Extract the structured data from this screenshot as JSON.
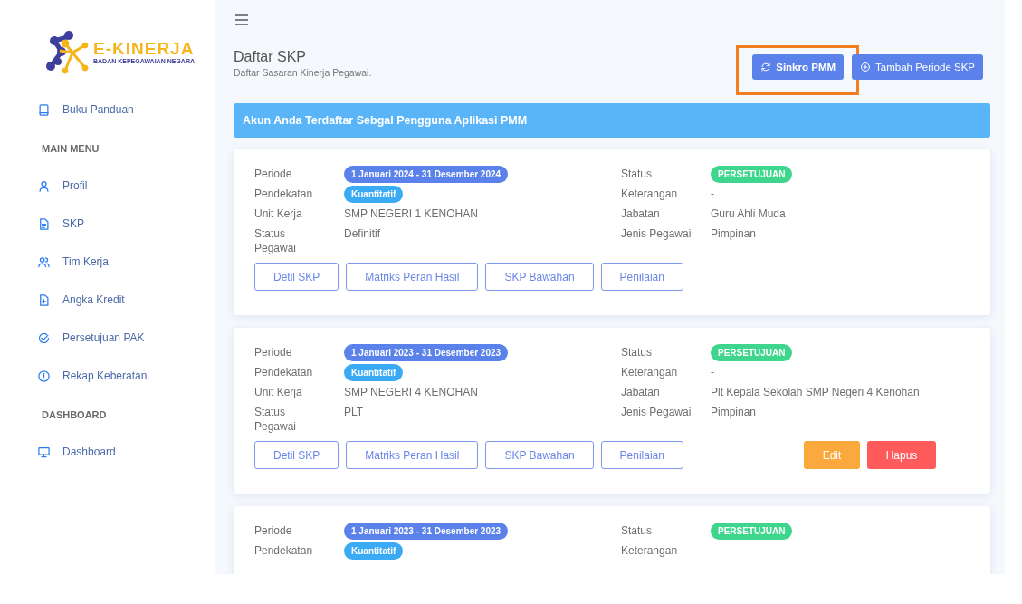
{
  "logo": {
    "title": "E-KINERJA",
    "subtitle": "BADAN KEPEGAWAIAN NEGARA"
  },
  "sidebar": {
    "sections": [
      {
        "items": [
          {
            "label": "Buku Panduan"
          }
        ]
      },
      {
        "heading": "MAIN MENU",
        "items": [
          {
            "label": "Profil"
          },
          {
            "label": "SKP"
          },
          {
            "label": "Tim Kerja"
          },
          {
            "label": "Angka Kredit"
          },
          {
            "label": "Persetujuan PAK"
          },
          {
            "label": "Rekap Keberatan"
          }
        ]
      },
      {
        "heading": "DASHBOARD",
        "items": [
          {
            "label": "Dashboard"
          }
        ]
      }
    ]
  },
  "page": {
    "title": "Daftar SKP",
    "subtitle": "Daftar Sasaran Kinerja Pegawai.",
    "actions": [
      {
        "label": "Sinkro PMM",
        "highlighted": true
      },
      {
        "label": "Tambah Periode SKP",
        "highlighted": false
      }
    ]
  },
  "banner": "Akun Anda Terdaftar Sebgal Pengguna Aplikasi PMM",
  "cards": [
    {
      "left": [
        {
          "label": "Periode",
          "value": "1 Januari 2024 - 31 Desember 2024",
          "kind": "badge",
          "color": "#5b82ea"
        },
        {
          "label": "Pendekatan",
          "value": "Kuantitatif",
          "kind": "badge",
          "color": "#3aaaf4"
        },
        {
          "label": "Unit Kerja",
          "value": "SMP NEGERI 1 KENOHAN",
          "kind": "text"
        },
        {
          "label": "Status Pegawai",
          "value": "Definitif",
          "kind": "text"
        }
      ],
      "right": [
        {
          "label": "Status",
          "value": "PERSETUJUAN",
          "kind": "badge",
          "color": "#3dd68c"
        },
        {
          "label": "Keterangan",
          "value": "-",
          "kind": "text"
        },
        {
          "label": "Jabatan",
          "value": "Guru Ahli Muda",
          "kind": "text"
        },
        {
          "label": "Jenis Pegawai",
          "value": "Pimpinan",
          "kind": "text"
        }
      ],
      "buttons": [
        "Detil SKP",
        "Matriks Peran Hasil",
        "SKP Bawahan",
        "Penilaian"
      ]
    },
    {
      "left": [
        {
          "label": "Periode",
          "value": "1 Januari 2023 - 31 Desember 2023",
          "kind": "badge",
          "color": "#5b82ea"
        },
        {
          "label": "Pendekatan",
          "value": "Kuantitatif",
          "kind": "badge",
          "color": "#3aaaf4"
        },
        {
          "label": "Unit Kerja",
          "value": "SMP NEGERI 4 KENOHAN",
          "kind": "text"
        },
        {
          "label": "Status Pegawai",
          "value": "PLT",
          "kind": "text"
        }
      ],
      "right": [
        {
          "label": "Status",
          "value": "PERSETUJUAN",
          "kind": "badge",
          "color": "#3dd68c"
        },
        {
          "label": "Keterangan",
          "value": "-",
          "kind": "text"
        },
        {
          "label": "Jabatan",
          "value": "Plt Kepala Sekolah SMP Negeri 4 Kenohan",
          "kind": "text"
        },
        {
          "label": "Jenis Pegawai",
          "value": "Pimpinan",
          "kind": "text"
        }
      ],
      "buttons": [
        "Detil SKP",
        "Matriks Peran Hasil",
        "SKP Bawahan",
        "Penilaian"
      ],
      "actions": [
        {
          "label": "Edit",
          "kind": "edit"
        },
        {
          "label": "Hapus",
          "kind": "delete"
        }
      ]
    },
    {
      "left": [
        {
          "label": "Periode",
          "value": "1 Januari 2023 - 31 Desember 2023",
          "kind": "badge",
          "color": "#5b82ea"
        },
        {
          "label": "Pendekatan",
          "value": "Kuantitatif",
          "kind": "badge",
          "color": "#3aaaf4"
        }
      ],
      "right": [
        {
          "label": "Status",
          "value": "PERSETUJUAN",
          "kind": "badge",
          "color": "#3dd68c"
        },
        {
          "label": "Keterangan",
          "value": "-",
          "kind": "text"
        }
      ]
    }
  ]
}
